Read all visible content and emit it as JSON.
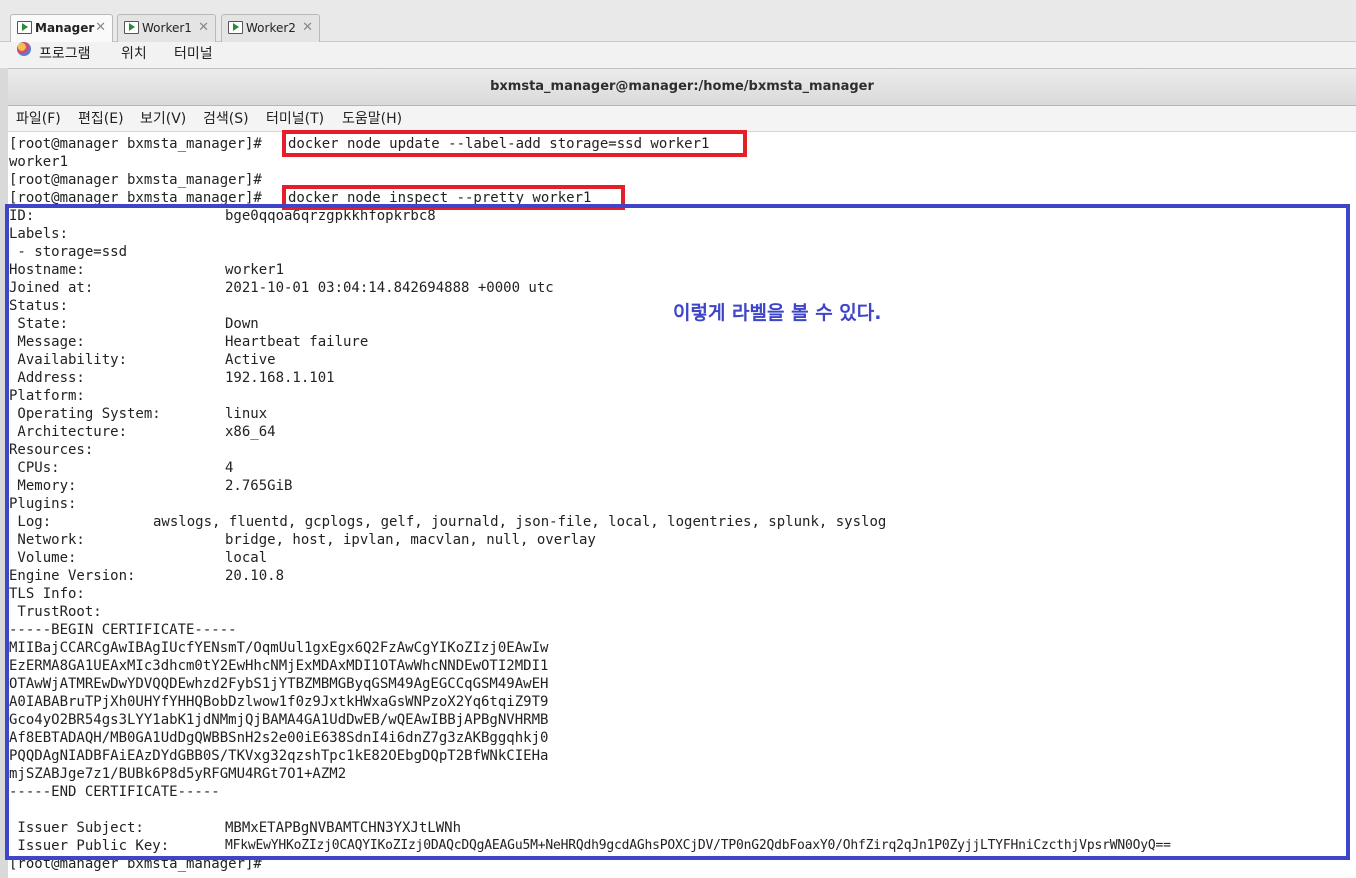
{
  "tabs": [
    {
      "label": "Manager",
      "active": true
    },
    {
      "label": "Worker1",
      "active": false
    },
    {
      "label": "Worker2",
      "active": false
    }
  ],
  "app_menu": {
    "programs": "프로그램",
    "places": "위치",
    "terminal": "터미널"
  },
  "window": {
    "title": "bxmsta_manager@manager:/home/bxmsta_manager"
  },
  "terminal_menu": [
    "파일(F)",
    "편집(E)",
    "보기(V)",
    "검색(S)",
    "터미널(T)",
    "도움말(H)"
  ],
  "prompt": "[root@manager bxmsta_manager]#",
  "commands": {
    "label_add": "docker node update --label-add storage=ssd worker1",
    "label_add_output": "worker1",
    "inspect": "docker node inspect --pretty worker1"
  },
  "inspect_output": {
    "id": {
      "key": "ID:",
      "value": "bge0qqoa6qrzgpkkhfopkrbc8"
    },
    "labels": {
      "key": "Labels:",
      "item": " - storage=ssd"
    },
    "hostname": {
      "key": "Hostname:",
      "value": "worker1"
    },
    "joined_at": {
      "key": "Joined at:",
      "value": "2021-10-01 03:04:14.842694888 +0000 utc"
    },
    "status": {
      "key": "Status:"
    },
    "state": {
      "key": " State:",
      "value": "Down"
    },
    "message": {
      "key": " Message:",
      "value": "Heartbeat failure"
    },
    "availability": {
      "key": " Availability:",
      "value": "Active"
    },
    "address": {
      "key": " Address:",
      "value": "192.168.1.101"
    },
    "platform": {
      "key": "Platform:"
    },
    "os": {
      "key": " Operating System:",
      "value": "linux"
    },
    "arch": {
      "key": " Architecture:",
      "value": "x86_64"
    },
    "resources": {
      "key": "Resources:"
    },
    "cpus": {
      "key": " CPUs:",
      "value": "4"
    },
    "memory": {
      "key": " Memory:",
      "value": "2.765GiB"
    },
    "plugins": {
      "key": "Plugins:"
    },
    "log": {
      "key": " Log:",
      "value": "awslogs, fluentd, gcplogs, gelf, journald, json-file, local, logentries, splunk, syslog"
    },
    "network": {
      "key": " Network:",
      "value": "bridge, host, ipvlan, macvlan, null, overlay"
    },
    "volume": {
      "key": " Volume:",
      "value": "local"
    },
    "engine_version": {
      "key": "Engine Version:",
      "value": "20.10.8"
    },
    "tls_info": {
      "key": "TLS Info:"
    },
    "trust_root": {
      "key": " TrustRoot:"
    },
    "certificate": [
      "-----BEGIN CERTIFICATE-----",
      "MIIBajCCARCgAwIBAgIUcfYENsmT/OqmUul1gxEgx6Q2FzAwCgYIKoZIzj0EAwIw",
      "EzERMA8GA1UEAxMIc3dhcm0tY2EwHhcNMjExMDAxMDI1OTAwWhcNNDEwOTI2MDI1",
      "OTAwWjATMREwDwYDVQQDEwhzd2FybS1jYTBZMBMGByqGSM49AgEGCCqGSM49AwEH",
      "A0IABABruTPjXh0UHYfYHHQBobDzlwow1f0z9JxtkHWxaGsWNPzoX2Yq6tqiZ9T9",
      "Gco4yO2BR54gs3LYY1abK1jdNMmjQjBAMA4GA1UdDwEB/wQEAwIBBjAPBgNVHRMB",
      "Af8EBTADAQH/MB0GA1UdDgQWBBSnH2s2e00iE638SdnI4i6dnZ7g3zAKBggqhkj0",
      "PQQDAgNIADBFAiEAzDYdGBB0S/TKVxg32qzshTpc1kE82OEbgDQpT2BfWNkCIEHa",
      "mjSZABJge7z1/BUBk6P8d5yRFGMU4RGt7O1+AZM2",
      "-----END CERTIFICATE-----"
    ],
    "issuer_subject": {
      "key": " Issuer Subject:",
      "value": "MBMxETAPBgNVBAMTCHN3YXJtLWNh"
    },
    "issuer_public_key": {
      "key": " Issuer Public Key:",
      "value": "MFkwEwYHKoZIzj0CAQYIKoZIzj0DAQcDQgAEAGu5M+NeHRQdh9gcdAGhsPOXCjDV/TP0nG2QdbFoaxY0/OhfZirq2qJn1P0ZyjjLTYFHniCzcthjVpsrWN0OyQ=="
    }
  },
  "annotation": "이렇게 라벨을 볼 수 있다.",
  "colors": {
    "highlight_command": "#e3202a",
    "highlight_output": "#3e45c7",
    "annotation": "#3e45c7"
  }
}
